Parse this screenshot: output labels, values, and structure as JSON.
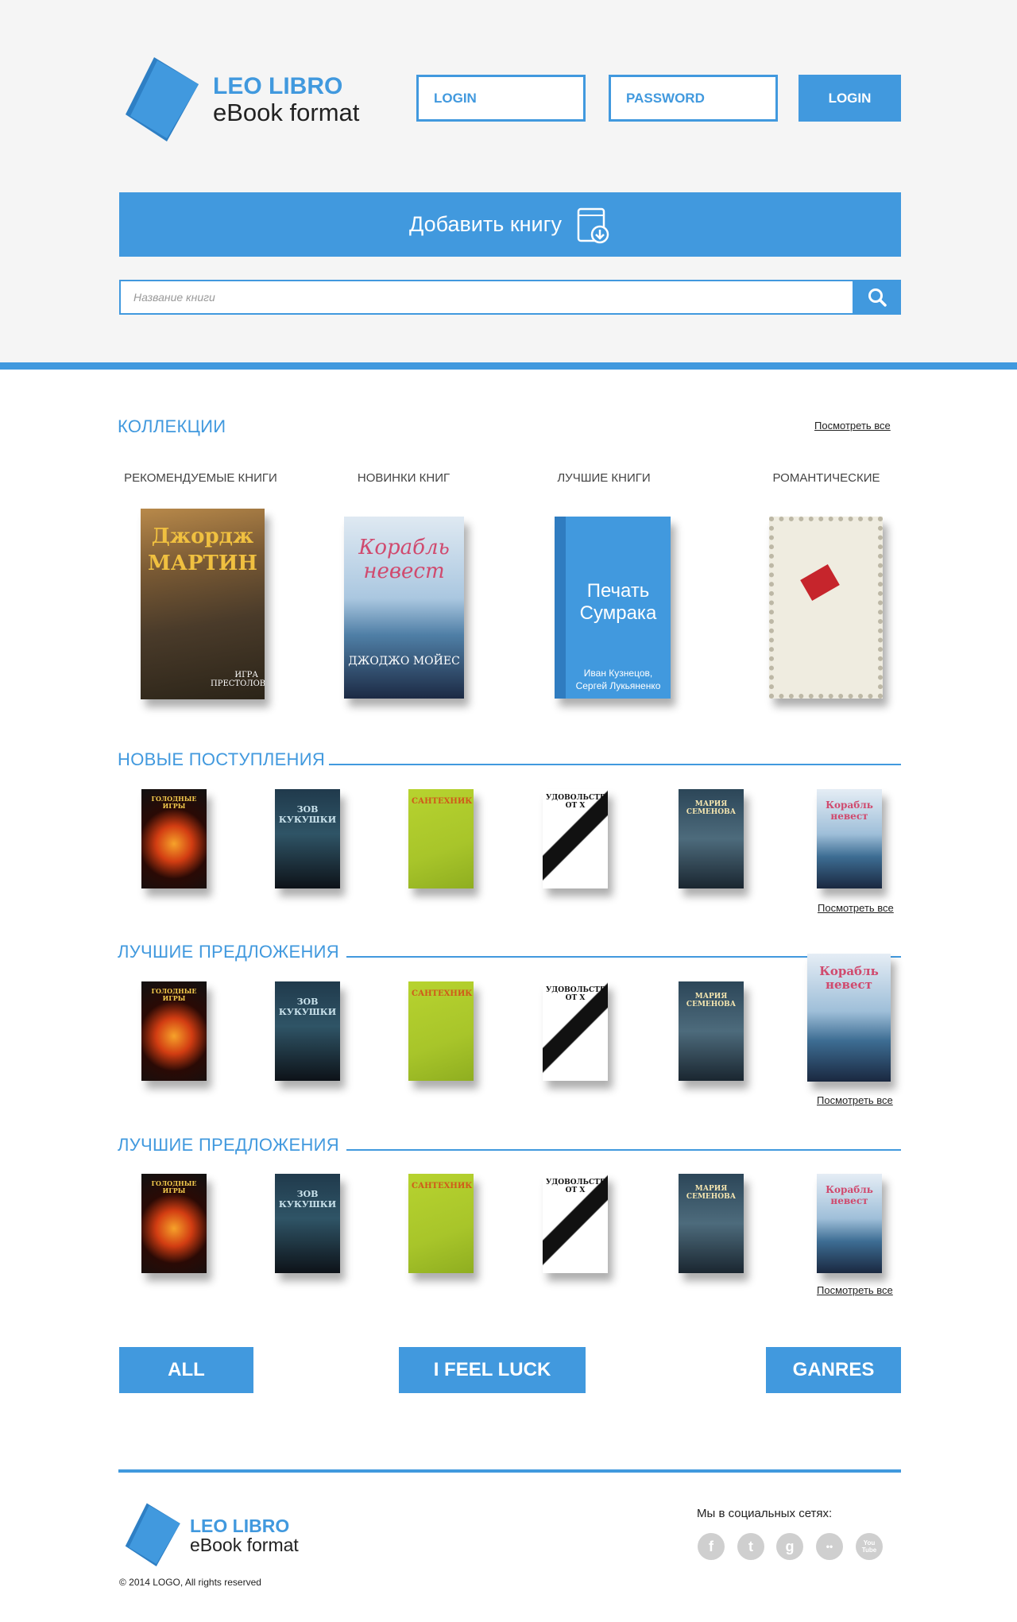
{
  "header": {
    "logo_title": "LEO LIBRO",
    "logo_subtitle": "eBook format",
    "login_placeholder": "LOGIN",
    "password_placeholder": "PASSWORD",
    "login_button": "LOGIN",
    "add_book_button": "Добавить книгу",
    "search_placeholder": "Название книги"
  },
  "collections": {
    "title": "КОЛЛЕКЦИИ",
    "see_all": "Посмотреть все",
    "items": [
      {
        "label": "РЕКОМЕНДУЕМЫЕ КНИГИ",
        "cover_title": "Джордж МАРТИН",
        "cover_sub": "ИГРА ПРЕСТОЛОВ"
      },
      {
        "label": "НОВИНКИ КНИГ",
        "cover_title": "Корабль невест",
        "cover_sub": "ДЖОДЖО МОЙЕС"
      },
      {
        "label": "ЛУЧШИЕ КНИГИ",
        "cover_title": "Печать Сумрака",
        "cover_sub": "Иван Кузнецов, Сергей Лукьяненко"
      },
      {
        "label": "РОМАНТИЧЕСКИЕ",
        "cover_title": "",
        "cover_sub": ""
      }
    ]
  },
  "sections": [
    {
      "title": "НОВЫЕ ПОСТУПЛЕНИЯ",
      "see_all": "Посмотреть все"
    },
    {
      "title": "ЛУЧШИЕ ПРЕДЛОЖЕНИЯ",
      "see_all": "Посмотреть все"
    },
    {
      "title": "ЛУЧШИЕ ПРЕДЛОЖЕНИЯ",
      "see_all": "Посмотреть все"
    }
  ],
  "books": [
    {
      "title": "ГОЛОДНЫЕ ИГРЫ",
      "kind": "hunger"
    },
    {
      "title": "ЗОВ КУКУШКИ",
      "kind": "cuckoo"
    },
    {
      "title": "САНТЕХНИК",
      "kind": "plumber"
    },
    {
      "title": "УДОВОЛЬСТВИЕ ОТ Х",
      "kind": "x"
    },
    {
      "title": "МАРИЯ СЕМЕНОВА",
      "kind": "semenova"
    },
    {
      "title": "Корабль невест",
      "kind": "ship"
    }
  ],
  "buttons": {
    "all": "ALL",
    "luck": "I FEEL LUCK",
    "genres": "GANRES"
  },
  "footer": {
    "logo_title": "LEO LIBRO",
    "logo_subtitle": "eBook format",
    "copyright": "© 2014 LOGO, All rights reserved",
    "social_title": "Мы в социальных сетях:",
    "social": [
      {
        "icon": "facebook-icon",
        "glyph": "f"
      },
      {
        "icon": "twitter-icon",
        "glyph": "t"
      },
      {
        "icon": "google-icon",
        "glyph": "g"
      },
      {
        "icon": "flickr-icon",
        "glyph": "••"
      },
      {
        "icon": "youtube-icon",
        "glyph": "You Tube"
      }
    ]
  },
  "colors": {
    "accent": "#4199de",
    "background": "#f5f5f5"
  }
}
